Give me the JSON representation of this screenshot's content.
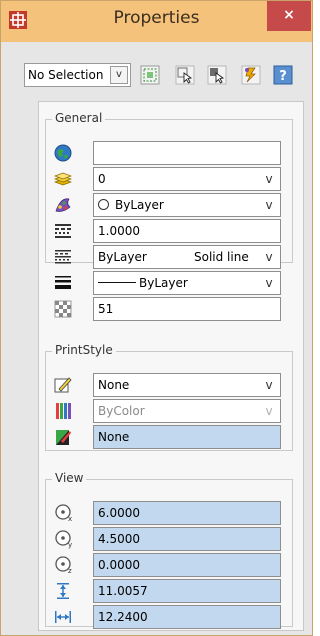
{
  "window": {
    "title": "Properties",
    "close_glyph": "×"
  },
  "toolbar": {
    "selection_value": "No Selection",
    "arrow_glyph": "v",
    "buttons": [
      {
        "name": "quick-select-icon"
      },
      {
        "name": "select-objects-icon"
      },
      {
        "name": "toggle-pickadd-icon"
      },
      {
        "name": "quick-properties-icon"
      },
      {
        "name": "help-icon"
      }
    ]
  },
  "general": {
    "label": "General",
    "rows": [
      {
        "icon": "globe-icon",
        "value": ""
      },
      {
        "icon": "layer-icon",
        "value": "0"
      },
      {
        "icon": "color-icon",
        "value": "ByLayer"
      },
      {
        "icon": "linetype-scale-icon",
        "value": "1.0000"
      },
      {
        "icon": "linetype-icon",
        "value": "ByLayer",
        "value2": "Solid line"
      },
      {
        "icon": "lineweight-icon",
        "value": "ByLayer"
      },
      {
        "icon": "transparency-icon",
        "value": "51"
      }
    ]
  },
  "print_style": {
    "label": "PrintStyle",
    "rows": [
      {
        "icon": "plot-style-icon",
        "value": "None"
      },
      {
        "icon": "plot-color-icon",
        "value": "ByColor"
      },
      {
        "icon": "plot-table-icon",
        "value": "None"
      }
    ]
  },
  "view": {
    "label": "View",
    "rows": [
      {
        "icon": "center-x-icon",
        "value": "6.0000"
      },
      {
        "icon": "center-y-icon",
        "value": "4.5000"
      },
      {
        "icon": "center-z-icon",
        "value": "0.0000"
      },
      {
        "icon": "height-icon",
        "value": "11.0057"
      },
      {
        "icon": "width-icon",
        "value": "12.2400"
      }
    ]
  },
  "colors": {
    "titlebar": "#f4c27a",
    "close": "#c74a4a",
    "selected_field": "#c2d8ee"
  }
}
